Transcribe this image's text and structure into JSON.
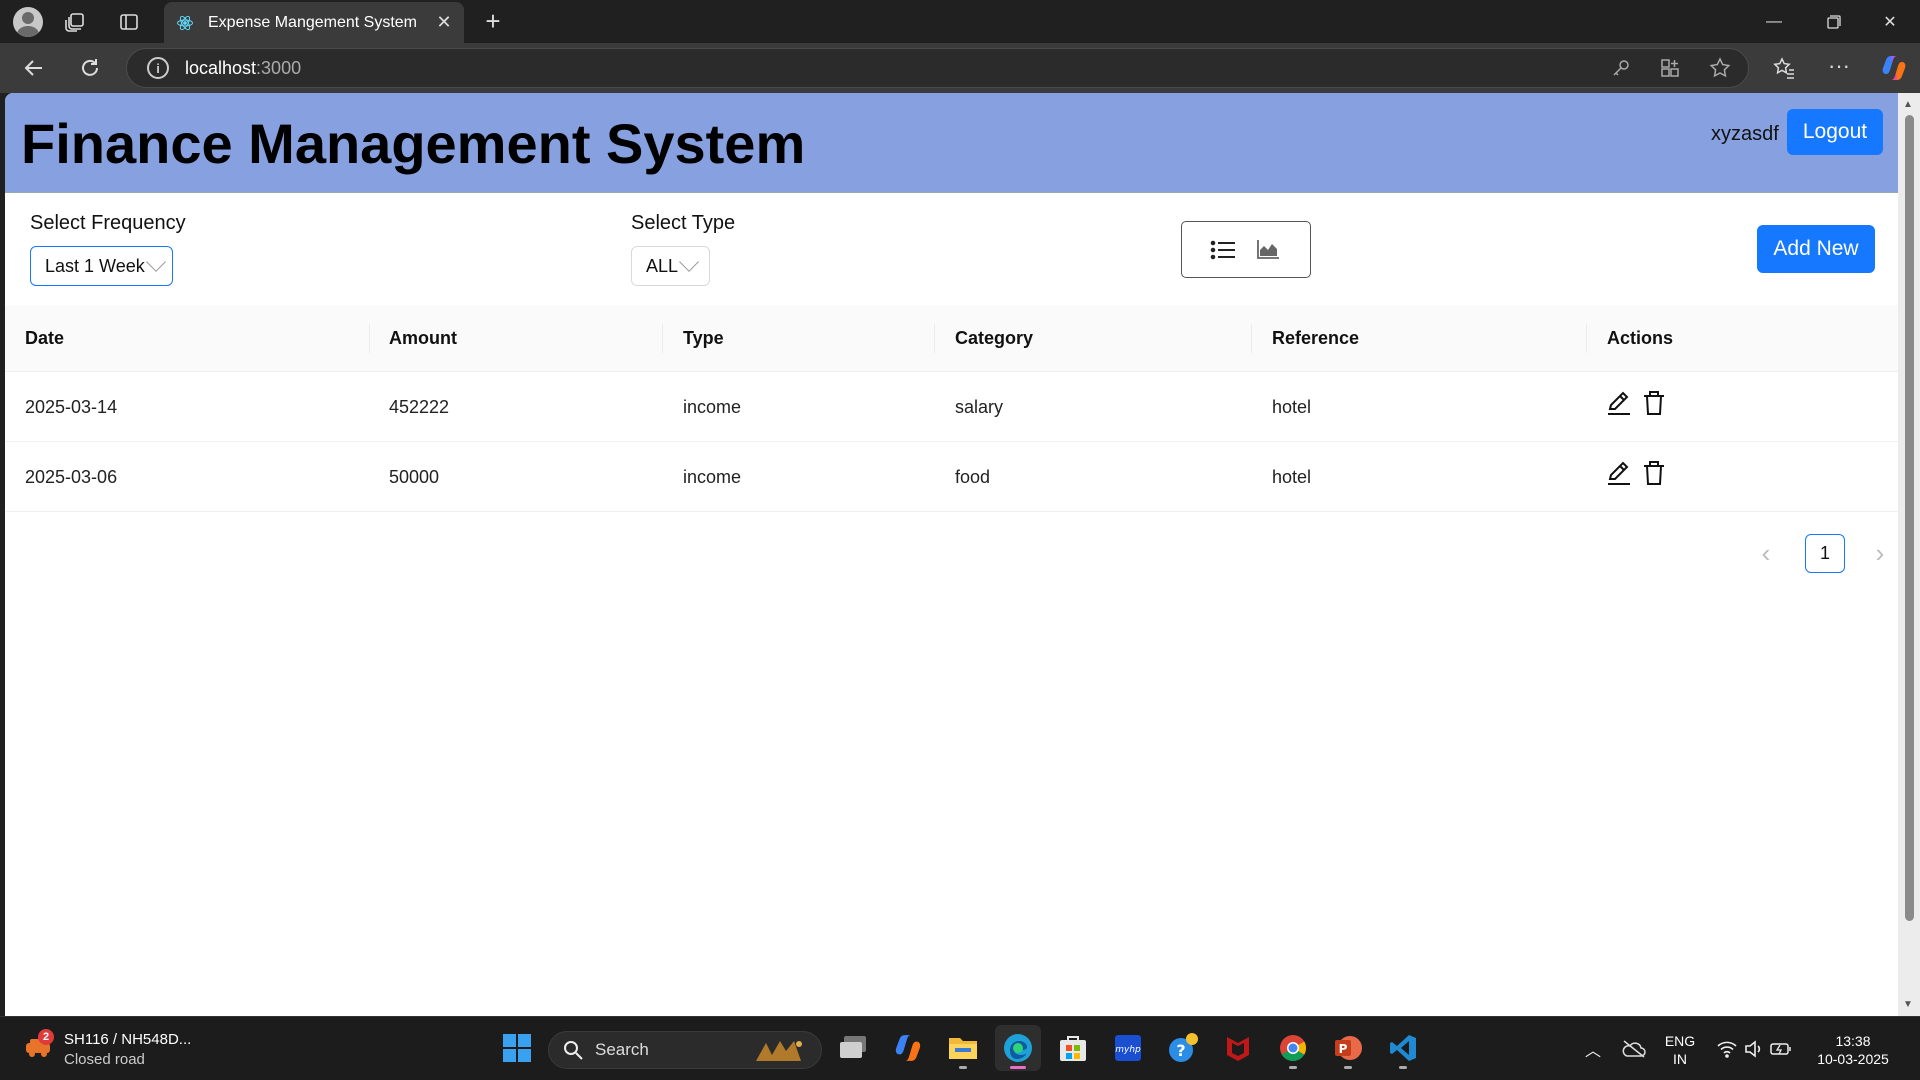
{
  "browser": {
    "tab_title": "Expense Mangement System",
    "url_host": "localhost",
    "url_port": ":3000"
  },
  "app": {
    "title": "Finance Management System",
    "username": "xyzasdf",
    "logout_label": "Logout",
    "accent_color": "#1677ff",
    "header_color": "#87a0df"
  },
  "filters": {
    "frequency_label": "Select Frequency",
    "frequency_value": "Last 1 Week",
    "type_label": "Select Type",
    "type_value": "ALL",
    "view_icons": [
      "list-icon",
      "area-chart-icon"
    ],
    "add_label": "Add New"
  },
  "table": {
    "columns": [
      "Date",
      "Amount",
      "Type",
      "Category",
      "Reference",
      "Actions"
    ],
    "rows": [
      {
        "date": "2025-03-14",
        "amount": "452222",
        "type": "income",
        "category": "salary",
        "reference": "hotel"
      },
      {
        "date": "2025-03-06",
        "amount": "50000",
        "type": "income",
        "category": "food",
        "reference": "hotel"
      }
    ],
    "action_icons": [
      "edit-icon",
      "delete-icon"
    ]
  },
  "pagination": {
    "current_page": "1"
  },
  "taskbar": {
    "weather_badge": "2",
    "weather_title": "SH116 / NH548D...",
    "weather_subtitle": "Closed road",
    "search_label": "Search",
    "lang_line1": "ENG",
    "lang_line2": "IN",
    "time": "13:38",
    "date": "10-03-2025"
  }
}
